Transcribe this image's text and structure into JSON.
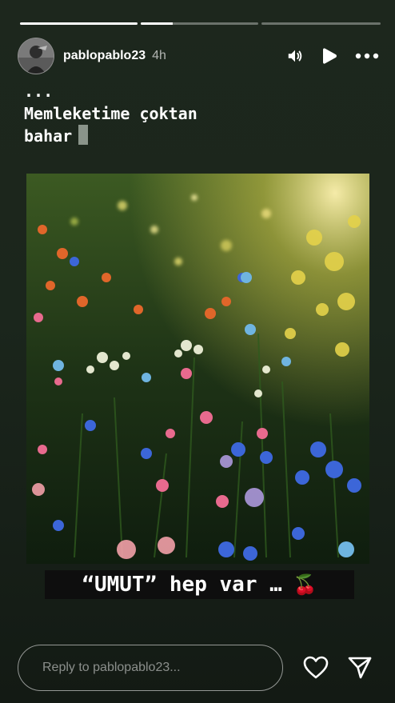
{
  "story": {
    "progress_segments": [
      {
        "label": "segment-1",
        "fill_fraction": 1.0
      },
      {
        "label": "segment-2",
        "fill_fraction": 0.27
      },
      {
        "label": "segment-3",
        "fill_fraction": 0.0
      }
    ],
    "username": "pablopablo23",
    "time": "4h",
    "caption_lines": [
      "...",
      "Memleketime çoktan",
      "bahar"
    ],
    "sticker_text": "“UMUT” hep var …",
    "sticker_emoji": "🍒"
  },
  "icons": {
    "mute": "speaker-icon",
    "play": "play-icon",
    "more": "more-icon",
    "like": "heart-icon",
    "share": "send-icon"
  },
  "reply": {
    "placeholder": "Reply to pablopablo23..."
  },
  "colors": {
    "background_top": "#1d271d",
    "background_bottom": "#131a14",
    "sticker_bg": "#0e0e0e"
  }
}
